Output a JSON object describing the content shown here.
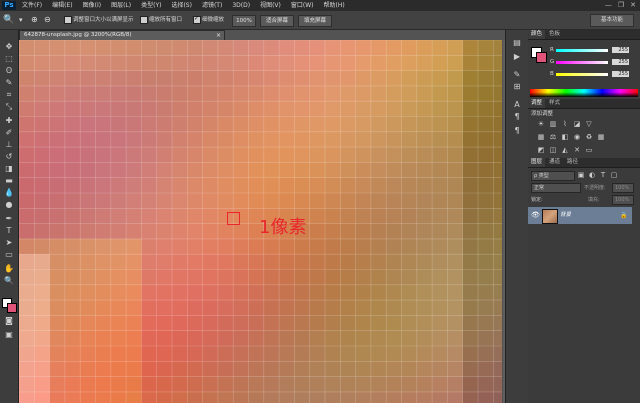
{
  "app": {
    "logo": "Ps"
  },
  "menu": [
    "文件(F)",
    "编辑(E)",
    "图像(I)",
    "图层(L)",
    "类型(Y)",
    "选择(S)",
    "滤镜(T)",
    "3D(D)",
    "视图(V)",
    "窗口(W)",
    "帮助(H)"
  ],
  "window_controls": [
    "—",
    "❐",
    "✕"
  ],
  "options": {
    "checkbox1_label": "调整窗口大小以满屏显示",
    "checkbox2_label": "缩放所有窗口",
    "checkbox3_label": "细微缩放",
    "zoom_button": "100%",
    "fit_button": "适合屏幕",
    "fill_button": "填充屏幕",
    "workspace": "基本功能"
  },
  "document": {
    "tab_title": "642878-unsplash.jpg @ 3200%(RGB/8)",
    "close": "×",
    "annotation": "1像素"
  },
  "colors": {
    "accent_red": "#e8262b",
    "selection_blue": "#6c7e96"
  },
  "color_panel": {
    "tabs": [
      "颜色",
      "色板"
    ],
    "channels": [
      {
        "label": "R",
        "value": "255"
      },
      {
        "label": "G",
        "value": "255"
      },
      {
        "label": "B",
        "value": "255"
      }
    ]
  },
  "adjust_panel": {
    "tabs": [
      "调整",
      "样式"
    ],
    "heading": "添加调整"
  },
  "layers_panel": {
    "tabs": [
      "图层",
      "通道",
      "路径"
    ],
    "filter": "ρ 类型",
    "blend_mode": "正常",
    "opacity_label": "不透明度:",
    "opacity_value": "100%",
    "lock_label": "锁定:",
    "fill_label": "填充:",
    "fill_value": "100%",
    "layer_name": "背景"
  }
}
